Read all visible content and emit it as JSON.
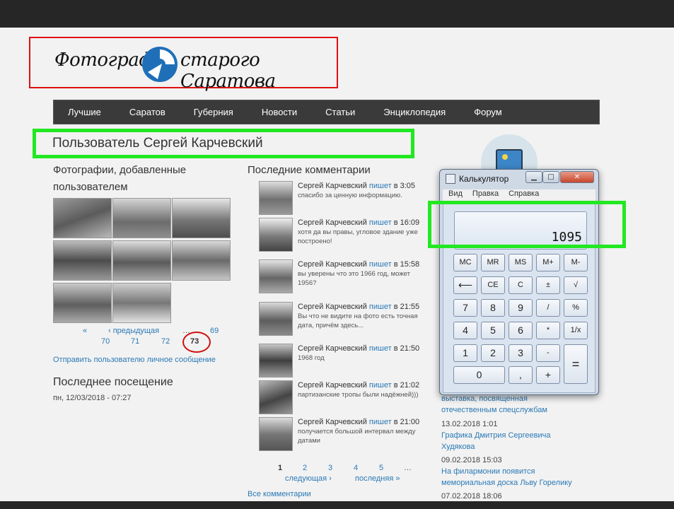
{
  "logo": {
    "part1": "Фотографии",
    "part2": "старого Саратова"
  },
  "menu": [
    "Лучшие",
    "Саратов",
    "Губерния",
    "Новости",
    "Статьи",
    "Энциклопедия",
    "Форум"
  ],
  "page_title": "Пользователь Сергей Карчевский",
  "photos_heading_1": "Фотографии, добавленные",
  "photos_heading_2": "пользователем",
  "photo_pager": {
    "first": "«",
    "prev": "‹ предыдущая",
    "ellipsis": "…",
    "p69": "69",
    "p70": "70",
    "p71": "71",
    "p72": "72",
    "p73": "73"
  },
  "send_message": "Отправить пользователю личное сообщение",
  "last_visit_heading": "Последнее посещение",
  "last_visit_value": "пн, 12/03/2018 - 07:27",
  "comments_heading": "Последние комментарии",
  "comments": [
    {
      "author": "Сергей Карчевский",
      "verb": "пишет",
      "when": "в 3:05",
      "text": "спасибо за ценную информацию."
    },
    {
      "author": "Сергей Карчевский",
      "verb": "пишет",
      "when": "в 16:09",
      "text": "хотя да вы правы, угловое здание уже построено!"
    },
    {
      "author": "Сергей Карчевский",
      "verb": "пишет",
      "when": "в 15:58",
      "text": "вы уверены что это 1966 год, может 1956?"
    },
    {
      "author": "Сергей Карчевский",
      "verb": "пишет",
      "when": "в 21:55",
      "text": "Вы что не видите на фото есть точная дата, причём здесь..."
    },
    {
      "author": "Сергей Карчевский",
      "verb": "пишет",
      "when": "в 21:50",
      "text": "1968 год"
    },
    {
      "author": "Сергей Карчевский",
      "verb": "пишет",
      "when": "в 21:02",
      "text": "партизанские тропы были надёжней)))"
    },
    {
      "author": "Сергей Карчевский",
      "verb": "пишет",
      "when": "в 21:00",
      "text": "получается большой интервал между датами"
    }
  ],
  "comments_pager": {
    "p1": "1",
    "p2": "2",
    "p3": "3",
    "p4": "4",
    "p5": "5",
    "ellipsis": "…",
    "next": "следующая ›",
    "last": "последняя »"
  },
  "all_comments": "Все комментарии",
  "news": [
    {
      "date": "",
      "title_1": "выставка, посвященная",
      "title_2": "отечественным спецслужбам"
    },
    {
      "date": "13.02.2018 1:01",
      "title_1": "Графика Дмитрия Сергеевича",
      "title_2": "Худякова"
    },
    {
      "date": "09.02.2018 15:03",
      "title_1": "На филармонии появится",
      "title_2": "мемориальная доска Льву Горелику"
    },
    {
      "date": "07.02.2018 18:06",
      "title_1": "",
      "title_2": ""
    }
  ],
  "calculator": {
    "title": "Калькулятор",
    "menu": [
      "Вид",
      "Правка",
      "Справка"
    ],
    "display": "1095",
    "minimize": "▁",
    "maximize": "□",
    "close": "✕",
    "keys": {
      "mc": "MC",
      "mr": "MR",
      "ms": "MS",
      "mplus": "M+",
      "mminus": "M-",
      "back": "⟵",
      "ce": "CE",
      "c": "C",
      "pm": "±",
      "sqrt": "√",
      "k7": "7",
      "k8": "8",
      "k9": "9",
      "div": "/",
      "pct": "%",
      "k4": "4",
      "k5": "5",
      "k6": "6",
      "mul": "*",
      "inv": "1/x",
      "k1": "1",
      "k2": "2",
      "k3": "3",
      "minus": "-",
      "eq": "=",
      "k0": "0",
      "dot": ",",
      "plus": "+"
    }
  },
  "colors": {
    "annotation_green": "#22e822",
    "annotation_red": "#e01010",
    "link": "#2b79b5",
    "menu_bg": "#3a3a3a"
  }
}
